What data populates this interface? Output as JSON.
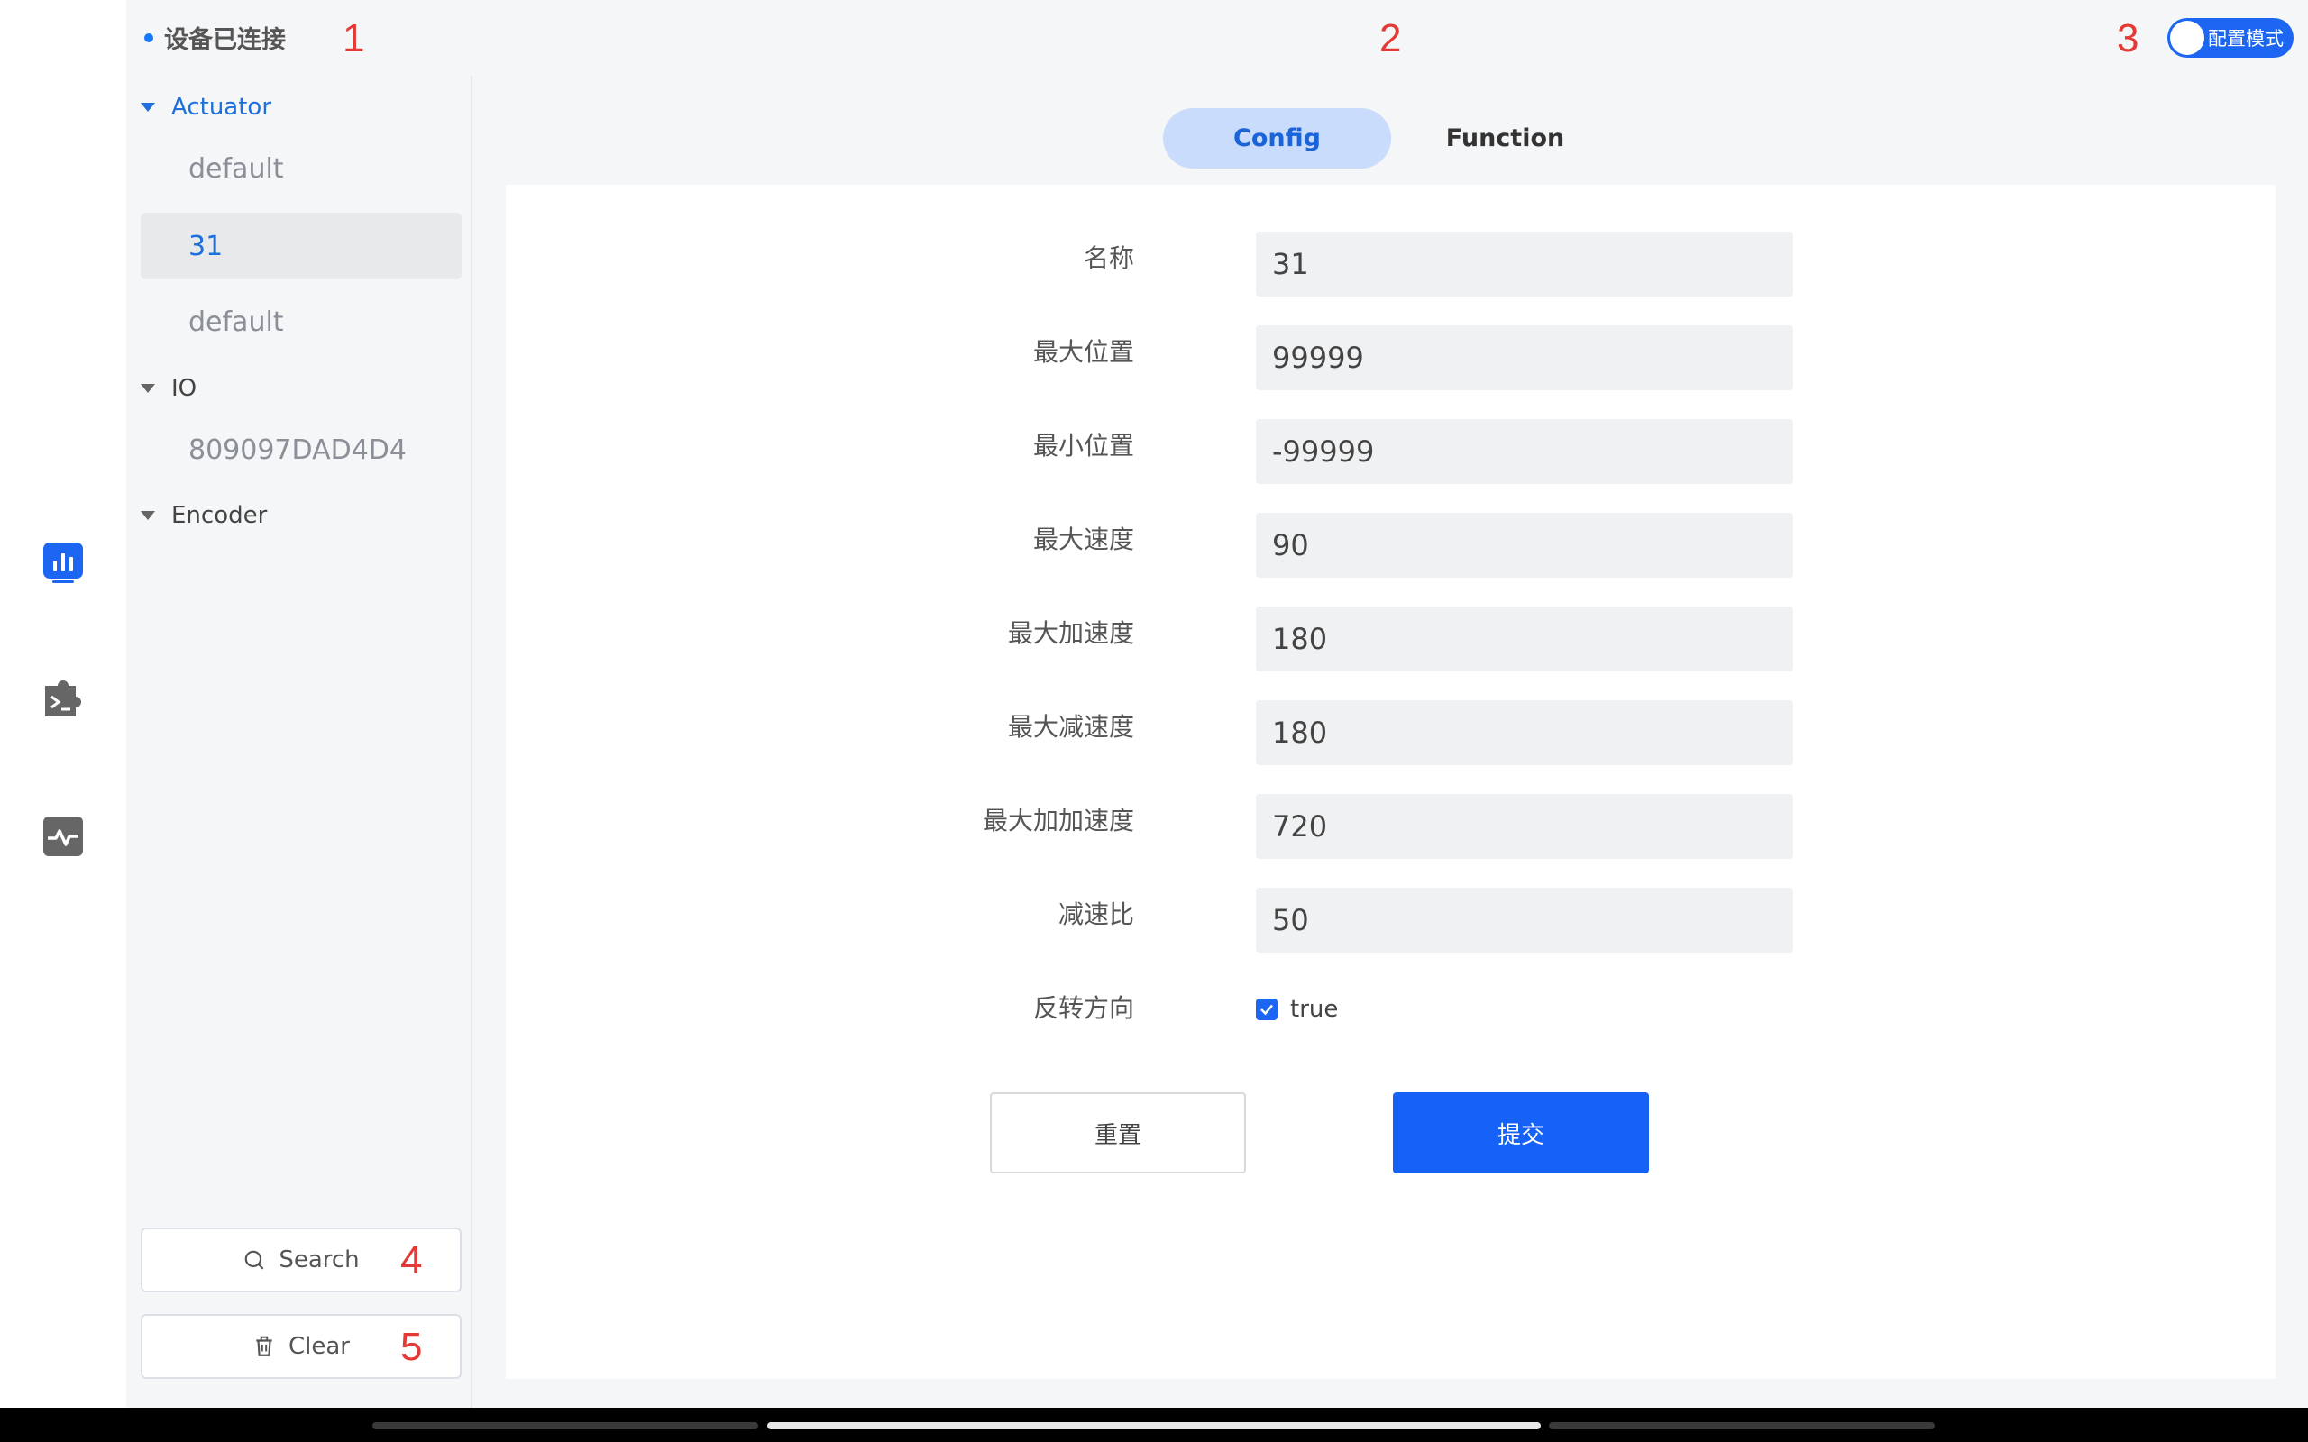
{
  "header": {
    "status_text": "设备已连接",
    "mode_toggle_label": "配置模式"
  },
  "annotations": [
    "1",
    "2",
    "3",
    "4",
    "5"
  ],
  "nav_rail": {
    "icons": [
      "chart-icon",
      "terminal-puzzle-icon",
      "pulse-icon"
    ],
    "active_color": "#1c66f2"
  },
  "tree": {
    "groups": [
      {
        "label": "Actuator",
        "items": [
          "default",
          "31",
          "default"
        ]
      },
      {
        "label": "IO",
        "items": [
          "809097DAD4D4"
        ]
      },
      {
        "label": "Encoder",
        "items": []
      }
    ],
    "selected_item": "31"
  },
  "sidebar_buttons": {
    "search_label": "Search",
    "clear_label": "Clear"
  },
  "tabs": [
    {
      "label": "Config",
      "active": true
    },
    {
      "label": "Function",
      "active": false
    }
  ],
  "form": {
    "fields": [
      {
        "label": "名称",
        "value": "31"
      },
      {
        "label": "最大位置",
        "value": "99999"
      },
      {
        "label": "最小位置",
        "value": "-99999"
      },
      {
        "label": "最大速度",
        "value": "90"
      },
      {
        "label": "最大加速度",
        "value": "180"
      },
      {
        "label": "最大减速度",
        "value": "180"
      },
      {
        "label": "最大加加速度",
        "value": "720"
      },
      {
        "label": "减速比",
        "value": "50"
      }
    ],
    "reverse": {
      "label": "反转方向",
      "checkbox_text": "true",
      "checked": true
    },
    "reset_label": "重置",
    "submit_label": "提交"
  },
  "colors": {
    "accent": "#1c66f2",
    "selected_tree": "#1e6fd9",
    "annotation": "#e53935"
  }
}
